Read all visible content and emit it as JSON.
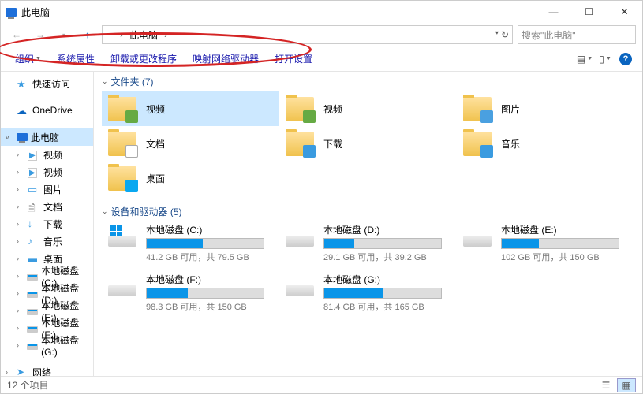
{
  "title": "此电脑",
  "breadcrumb": {
    "root": "此电脑"
  },
  "search": {
    "placeholder": "搜索\"此电脑\""
  },
  "toolbar": {
    "organize": "组织",
    "props": "系统属性",
    "uninstall": "卸载或更改程序",
    "mapnet": "映射网络驱动器",
    "settings": "打开设置"
  },
  "sidebar": {
    "quick": "快速访问",
    "onedrive": "OneDrive",
    "pc": "此电脑",
    "pc_children": [
      {
        "icon": "ic-vid",
        "label": "视频",
        "name": "nav-videos-1"
      },
      {
        "icon": "ic-vid",
        "label": "视频",
        "name": "nav-videos-2"
      },
      {
        "icon": "ic-pic",
        "label": "图片",
        "name": "nav-pictures"
      },
      {
        "icon": "ic-doc",
        "label": "文档",
        "name": "nav-documents"
      },
      {
        "icon": "ic-down",
        "label": "下载",
        "name": "nav-downloads"
      },
      {
        "icon": "ic-music",
        "label": "音乐",
        "name": "nav-music"
      },
      {
        "icon": "ic-desk",
        "label": "桌面",
        "name": "nav-desktop"
      },
      {
        "icon": "ic-drive",
        "label": "本地磁盘 (C:)",
        "name": "nav-drive-c"
      },
      {
        "icon": "ic-drive",
        "label": "本地磁盘 (D:)",
        "name": "nav-drive-d"
      },
      {
        "icon": "ic-drive",
        "label": "本地磁盘 (E:)",
        "name": "nav-drive-e"
      },
      {
        "icon": "ic-drive",
        "label": "本地磁盘 (F:)",
        "name": "nav-drive-f"
      },
      {
        "icon": "ic-drive",
        "label": "本地磁盘 (G:)",
        "name": "nav-drive-g"
      }
    ],
    "network": "网络"
  },
  "groups": {
    "folders_title": "文件夹 (7)",
    "drives_title": "设备和驱动器 (5)"
  },
  "folders": [
    {
      "label": "视频",
      "badge": "b-vid",
      "selected": true,
      "name": "folder-videos-1"
    },
    {
      "label": "视频",
      "badge": "b-vid",
      "selected": false,
      "name": "folder-videos-2"
    },
    {
      "label": "图片",
      "badge": "b-pic",
      "selected": false,
      "name": "folder-pictures"
    },
    {
      "label": "文档",
      "badge": "b-doc",
      "selected": false,
      "name": "folder-documents"
    },
    {
      "label": "下载",
      "badge": "b-down",
      "selected": false,
      "name": "folder-downloads"
    },
    {
      "label": "音乐",
      "badge": "b-music",
      "selected": false,
      "name": "folder-music"
    },
    {
      "label": "桌面",
      "badge": "b-desk",
      "selected": false,
      "name": "folder-desktop"
    }
  ],
  "drives": [
    {
      "name": "本地磁盘 (C:)",
      "stats": "41.2 GB 可用，共 79.5 GB",
      "pct": 48,
      "os": true,
      "dname": "drive-c"
    },
    {
      "name": "本地磁盘 (D:)",
      "stats": "29.1 GB 可用，共 39.2 GB",
      "pct": 26,
      "os": false,
      "dname": "drive-d"
    },
    {
      "name": "本地磁盘 (E:)",
      "stats": "102 GB 可用，共 150 GB",
      "pct": 32,
      "os": false,
      "dname": "drive-e"
    },
    {
      "name": "本地磁盘 (F:)",
      "stats": "98.3 GB 可用，共 150 GB",
      "pct": 35,
      "os": false,
      "dname": "drive-f"
    },
    {
      "name": "本地磁盘 (G:)",
      "stats": "81.4 GB 可用，共 165 GB",
      "pct": 51,
      "os": false,
      "dname": "drive-g"
    }
  ],
  "status": {
    "count": "12 个项目"
  }
}
